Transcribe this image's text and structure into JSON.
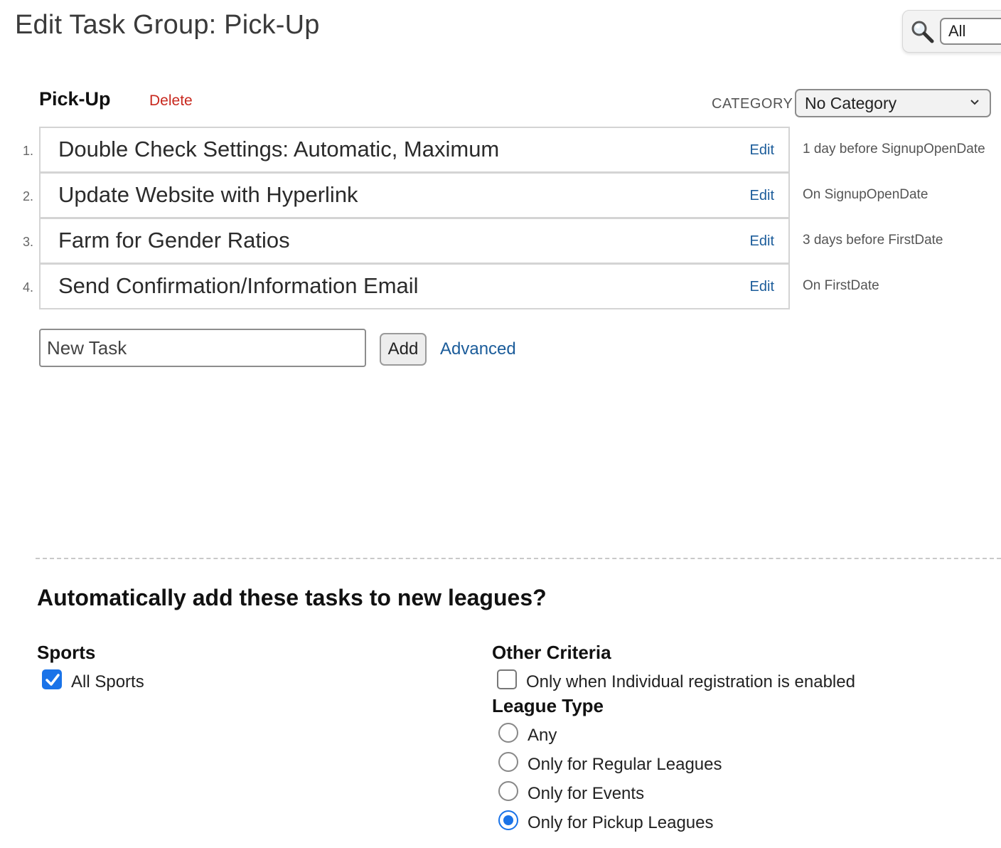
{
  "header": {
    "title": "Edit Task Group: Pick-Up",
    "search": {
      "icon": "magnifier-icon",
      "filter_value": "All"
    }
  },
  "group": {
    "name": "Pick-Up",
    "delete_label": "Delete",
    "category_label": "CATEGORY",
    "category_value": "No Category"
  },
  "tasks": [
    {
      "number": "1.",
      "name": "Double Check Settings: Automatic, Maximum",
      "edit_label": "Edit",
      "when": "1 day before SignupOpenDate"
    },
    {
      "number": "2.",
      "name": "Update Website with Hyperlink",
      "edit_label": "Edit",
      "when": "On SignupOpenDate"
    },
    {
      "number": "3.",
      "name": "Farm for Gender Ratios",
      "edit_label": "Edit",
      "when": "3 days before FirstDate"
    },
    {
      "number": "4.",
      "name": "Send Confirmation/Information Email",
      "edit_label": "Edit",
      "when": "On FirstDate"
    }
  ],
  "new_task": {
    "placeholder": "New Task",
    "add_label": "Add",
    "advanced_label": "Advanced"
  },
  "auto_add": {
    "heading": "Automatically add these tasks to new leagues?",
    "sports": {
      "label": "Sports",
      "all_sports_label": "All Sports",
      "all_sports_checked": true
    },
    "other_criteria": {
      "label": "Other Criteria",
      "individual_label": "Only when Individual registration is enabled",
      "individual_checked": false
    },
    "league_type": {
      "label": "League Type",
      "options": [
        {
          "label": "Any",
          "selected": false
        },
        {
          "label": "Only for Regular Leagues",
          "selected": false
        },
        {
          "label": "Only for Events",
          "selected": false
        },
        {
          "label": "Only for Pickup Leagues",
          "selected": true
        }
      ]
    }
  },
  "colors": {
    "accent": "#1a73e8",
    "link": "#1b5c9a",
    "danger": "#c8281e"
  }
}
